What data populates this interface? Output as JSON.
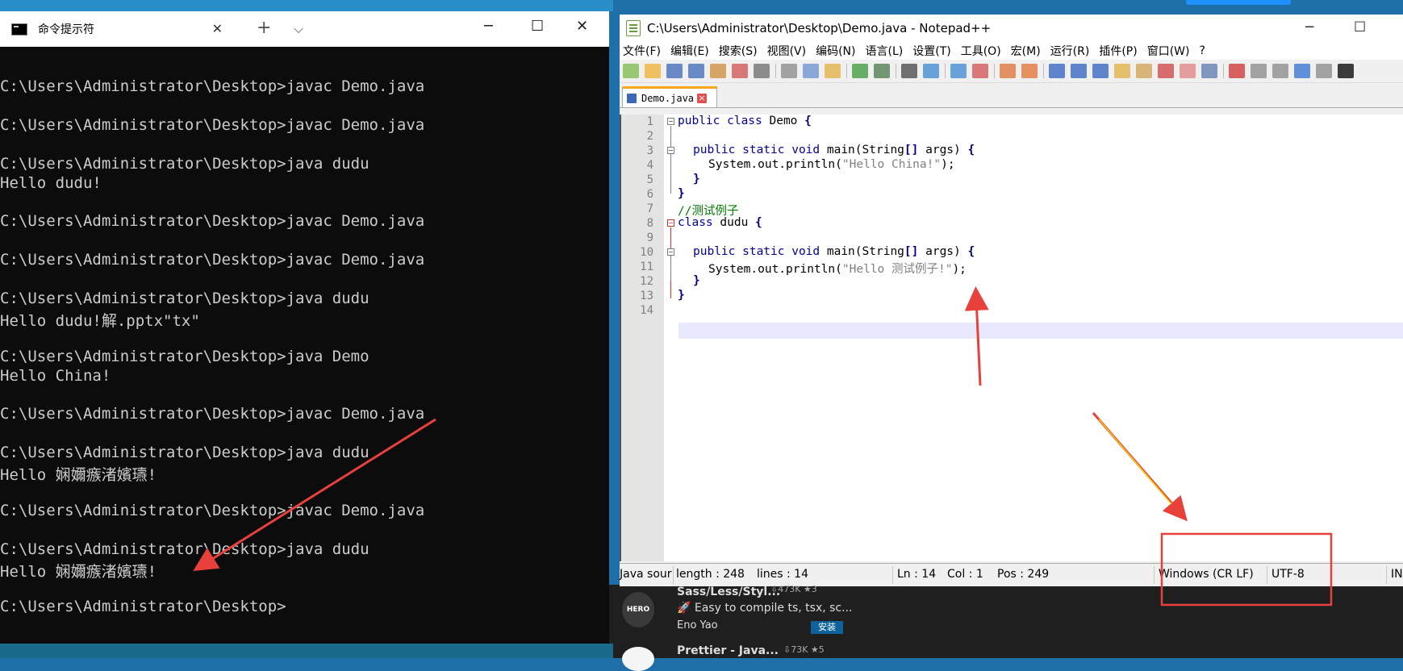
{
  "cmd": {
    "title": "命令提示符",
    "lines": [
      "C:\\Users\\Administrator\\Desktop>javac Demo.java",
      "",
      "C:\\Users\\Administrator\\Desktop>javac Demo.java",
      "",
      "C:\\Users\\Administrator\\Desktop>java dudu",
      "Hello dudu!",
      "",
      "C:\\Users\\Administrator\\Desktop>javac Demo.java",
      "",
      "C:\\Users\\Administrator\\Desktop>javac Demo.java",
      "",
      "C:\\Users\\Administrator\\Desktop>java dudu",
      "Hello dudu!解.pptx\"tx\"",
      "",
      "C:\\Users\\Administrator\\Desktop>java Demo",
      "Hello China!",
      "",
      "C:\\Users\\Administrator\\Desktop>javac Demo.java",
      "",
      "C:\\Users\\Administrator\\Desktop>java dudu",
      "Hello 娴嬭瘯渚嬪瓙!",
      "",
      "C:\\Users\\Administrator\\Desktop>javac Demo.java",
      "",
      "C:\\Users\\Administrator\\Desktop>java dudu",
      "Hello 娴嬭瘯渚嬪瓙!",
      "",
      "C:\\Users\\Administrator\\Desktop>"
    ]
  },
  "npp": {
    "title": "C:\\Users\\Administrator\\Desktop\\Demo.java - Notepad++",
    "menu": [
      "文件(F)",
      "编辑(E)",
      "搜索(S)",
      "视图(V)",
      "编码(N)",
      "语言(L)",
      "设置(T)",
      "工具(O)",
      "宏(M)",
      "运行(R)",
      "插件(P)",
      "窗口(W)",
      "?"
    ],
    "tab_name": "Demo.java",
    "line_numbers": [
      "1",
      "2",
      "3",
      "4",
      "5",
      "6",
      "7",
      "8",
      "9",
      "10",
      "11",
      "12",
      "13",
      "14"
    ],
    "code": {
      "l1_kw": "public class",
      "l1_rest": " Demo ",
      "l1_brace": "{",
      "l3_kw": "public static void",
      "l3_rest": " main(String",
      "l3_br": "[]",
      "l3_args": " args) ",
      "l3_brace": "{",
      "l4_pre": "System.out.println(",
      "l4_str": "\"Hello China!\"",
      "l4_post": ");",
      "l5": "}",
      "l6": "}",
      "l7": "//测试例子",
      "l8_kw": "class",
      "l8_rest": " dudu ",
      "l8_brace": "{",
      "l10_kw": "public static void",
      "l10_rest": " main(String",
      "l10_br": "[]",
      "l10_args": " args) ",
      "l10_brace": "{",
      "l11_pre": "System.out.println(",
      "l11_str": "\"Hello 测试例子!\"",
      "l11_post": ");",
      "l12": "}",
      "l13": "}"
    },
    "status": {
      "lang": "Java sour",
      "length": "length : 248",
      "lines": "lines : 14",
      "ln": "Ln : 14",
      "col": "Col : 1",
      "pos": "Pos : 249",
      "eol": "Windows (CR LF)",
      "enc": "UTF-8",
      "ins": "IN"
    }
  },
  "extensions": {
    "ext1_title": "Sass/Less/Styl...",
    "ext1_stats": "⇩473K ★3",
    "ext1_desc": "🚀 Easy to compile ts, tsx, sc...",
    "ext1_publisher": "Eno Yao",
    "ext1_install": "安装",
    "ext1_icon_text": "HERO",
    "ext2_title": "Prettier - Java...",
    "ext2_stats": "⇩73K ★5"
  },
  "colors": {
    "cmd_bg": "#0c0c0c",
    "cmd_text": "#cccccc",
    "keyword": "#00009a",
    "string": "#808080",
    "comment": "#008000",
    "arrow_red": "#e8403a",
    "highlight_box": "#e8403a"
  }
}
